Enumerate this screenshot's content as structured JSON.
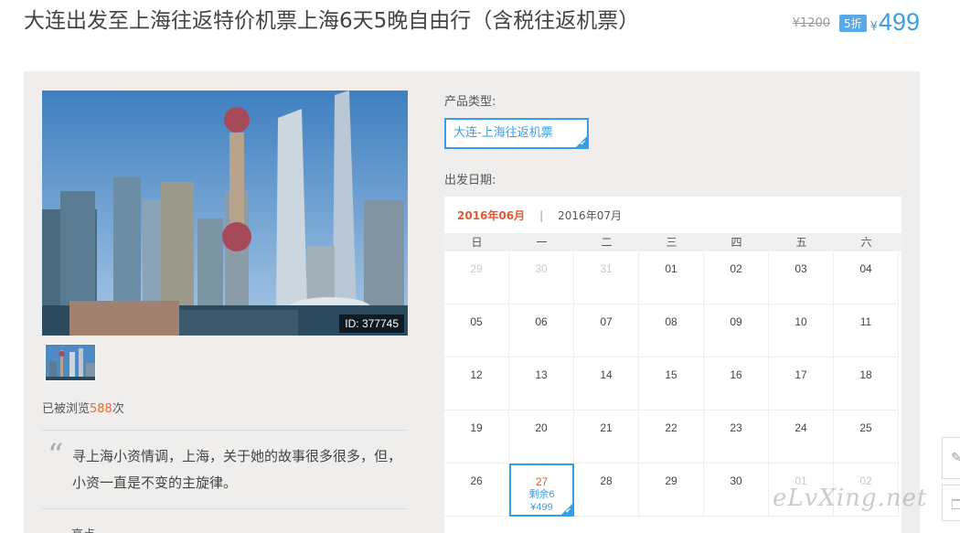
{
  "title": "大连出发至上海往返特价机票上海6天5晚自由行（含税往返机票）",
  "price": {
    "original": "¥1200",
    "discount": "5折",
    "currency": "¥",
    "current": "499"
  },
  "photo": {
    "id_label": "ID: 377745"
  },
  "views": {
    "prefix": "已被浏览",
    "count": "588",
    "suffix": "次"
  },
  "quote": {
    "mark": "“",
    "text": "寻上海小资情调，上海，关于她的故事很多很多，但，小资一直是不变的主旋律。",
    "partial_next": "亮点"
  },
  "product_type": {
    "label": "产品类型:",
    "option": "大连-上海往返机票"
  },
  "departure": {
    "label": "出发日期:"
  },
  "calendar": {
    "active_month": "2016年06月",
    "separator": "|",
    "next_month": "2016年07月",
    "weekdays": [
      "日",
      "一",
      "二",
      "三",
      "四",
      "五",
      "六"
    ],
    "weeks": [
      [
        {
          "d": "29",
          "m": true
        },
        {
          "d": "30",
          "m": true
        },
        {
          "d": "31",
          "m": true
        },
        {
          "d": "01"
        },
        {
          "d": "02"
        },
        {
          "d": "03"
        },
        {
          "d": "04"
        }
      ],
      [
        {
          "d": "05"
        },
        {
          "d": "06"
        },
        {
          "d": "07"
        },
        {
          "d": "08"
        },
        {
          "d": "09"
        },
        {
          "d": "10"
        },
        {
          "d": "11"
        }
      ],
      [
        {
          "d": "12"
        },
        {
          "d": "13"
        },
        {
          "d": "14"
        },
        {
          "d": "15"
        },
        {
          "d": "16"
        },
        {
          "d": "17"
        },
        {
          "d": "18"
        }
      ],
      [
        {
          "d": "19"
        },
        {
          "d": "20"
        },
        {
          "d": "21"
        },
        {
          "d": "22"
        },
        {
          "d": "23"
        },
        {
          "d": "24"
        },
        {
          "d": "25"
        }
      ],
      [
        {
          "d": "26"
        },
        {
          "d": "27",
          "sel": true,
          "remain": "剩余6",
          "price": "¥499"
        },
        {
          "d": "28"
        },
        {
          "d": "29"
        },
        {
          "d": "30"
        },
        {
          "d": "01",
          "m": true
        },
        {
          "d": "02",
          "m": true
        }
      ]
    ]
  },
  "watermark": "eLvXing.net",
  "colors": {
    "accent": "#3a9ee5",
    "highlight": "#e05a3a",
    "panel_bg": "#efeeec"
  }
}
